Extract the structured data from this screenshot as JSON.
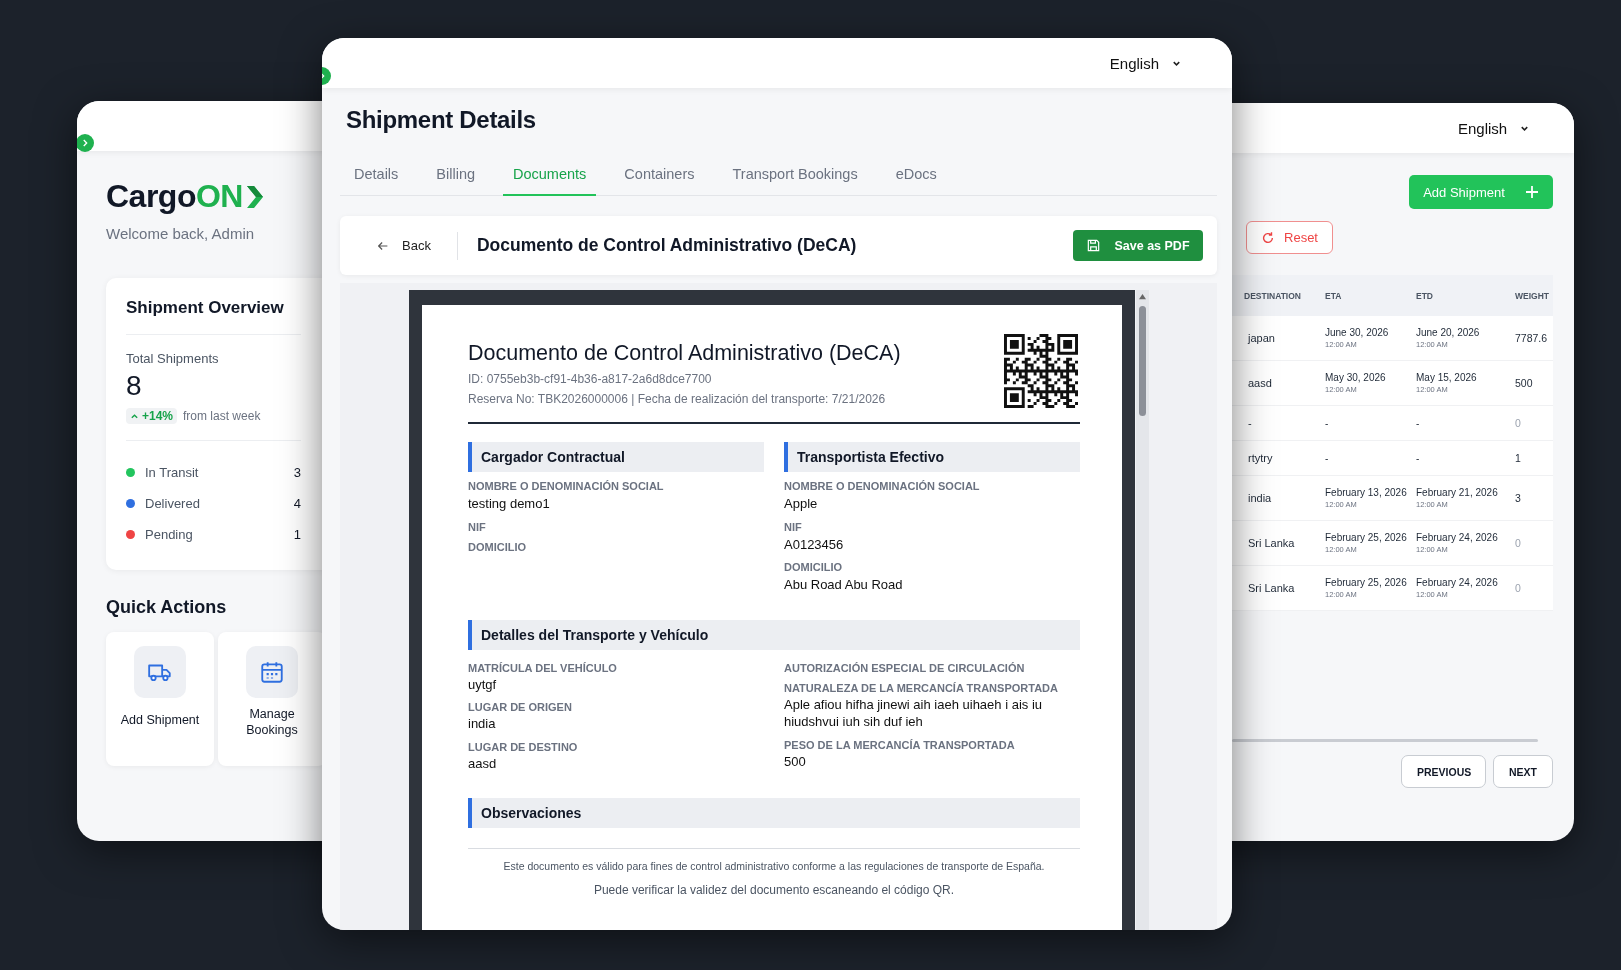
{
  "left_window": {
    "logo": {
      "text": "Cargo",
      "accent": "ON"
    },
    "welcome": "Welcome back, Admin",
    "overview": {
      "title": "Shipment Overview",
      "total_label": "Total Shipments",
      "total": "8",
      "change": "+14%",
      "change_note": "from last week",
      "statuses": [
        {
          "label": "In Transit",
          "count": "3",
          "color": "#22c55e"
        },
        {
          "label": "Delivered",
          "count": "4",
          "color": "#2f6fe0"
        },
        {
          "label": "Pending",
          "count": "1",
          "color": "#ef4444"
        }
      ]
    },
    "quick_actions": {
      "title": "Quick Actions",
      "items": [
        {
          "label": "Add Shipment",
          "kind": "truck"
        },
        {
          "label": "Manage Bookings",
          "kind": "calendar"
        }
      ]
    }
  },
  "center_window": {
    "language": "English",
    "title": "Shipment Details",
    "tabs": [
      {
        "label": "Details",
        "selected": false
      },
      {
        "label": "Billing",
        "selected": false
      },
      {
        "label": "Documents",
        "selected": true
      },
      {
        "label": "Containers",
        "selected": false
      },
      {
        "label": "Transport Bookings",
        "selected": false
      },
      {
        "label": "eDocs",
        "selected": false
      }
    ],
    "toolbar": {
      "back": "Back",
      "title": "Documento de Control Administrativo (DeCA)",
      "save": "Save as PDF"
    },
    "document": {
      "title": "Documento de Control Administrativo (DeCA)",
      "id_line": "ID: 0755eb3b-cf91-4b36-a817-2a6d8dce7700",
      "meta_line": "Reserva No: TBK2026000006 | Fecha de realización del transporte: 7/21/2026",
      "parties": [
        {
          "heading": "Cargador Contractual",
          "fields": [
            {
              "label": "NOMBRE O DENOMINACIÓN SOCIAL",
              "value": "testing demo1"
            },
            {
              "label": "NIF"
            },
            {
              "label": "DOMICILIO"
            }
          ]
        },
        {
          "heading": "Transportista Efectivo",
          "fields": [
            {
              "label": "NOMBRE O DENOMINACIÓN SOCIAL",
              "value": "Apple"
            },
            {
              "label": "NIF",
              "value": "A0123456"
            },
            {
              "label": "DOMICILIO",
              "value": "Abu Road Abu Road"
            }
          ]
        }
      ],
      "transport": {
        "heading": "Detalles del Transporte y Vehículo",
        "columns": [
          [
            {
              "label": "MATRÍCULA DEL VEHÍCULO",
              "value": "uytgf"
            },
            {
              "label": "LUGAR DE ORIGEN",
              "value": "india"
            },
            {
              "label": "LUGAR DE DESTINO",
              "value": "aasd"
            }
          ],
          [
            {
              "label": "AUTORIZACIÓN ESPECIAL DE CIRCULACIÓN"
            },
            {
              "label": "NATURALEZA DE LA MERCANCÍA TRANSPORTADA",
              "value": "Aple afiou hifha jinewi aih iaeh uihaeh i ais iu hiudshvui iuh sih duf ieh"
            },
            {
              "label": "PESO DE LA MERCANCÍA TRANSPORTADA",
              "value": "500"
            }
          ]
        ]
      },
      "observations": {
        "heading": "Observaciones"
      },
      "footer": [
        "Este documento es válido para fines de control administrativo conforme a las regulaciones de transporte de España.",
        "Puede verificar la validez del documento escaneando el código QR."
      ]
    }
  },
  "right_window": {
    "language": "English",
    "add_button": "Add Shipment",
    "reset_button": "Reset",
    "table": {
      "columns": [
        "DESTINATION",
        "ETA",
        "ETD",
        "WEIGHT"
      ],
      "rows": [
        {
          "destination": "japan",
          "eta": {
            "date": "June 30, 2026",
            "time": "12:00 AM"
          },
          "etd": {
            "date": "June 20, 2026",
            "time": "12:00 AM"
          },
          "weight": "7787.6",
          "weight_muted": false
        },
        {
          "destination": "aasd",
          "eta": {
            "date": "May 30, 2026",
            "time": "12:00 AM"
          },
          "etd": {
            "date": "May 15, 2026",
            "time": "12:00 AM"
          },
          "weight": "500",
          "weight_muted": false
        },
        {
          "destination": "-",
          "eta": {
            "date": "-"
          },
          "etd": {
            "date": "-"
          },
          "weight": "0",
          "weight_muted": true
        },
        {
          "destination": "rtytry",
          "eta": {
            "date": "-"
          },
          "etd": {
            "date": "-"
          },
          "weight": "1",
          "weight_muted": false
        },
        {
          "destination": "india",
          "eta": {
            "date": "February 13, 2026",
            "time": "12:00 AM"
          },
          "etd": {
            "date": "February 21, 2026",
            "time": "12:00 AM"
          },
          "weight": "3",
          "weight_muted": false
        },
        {
          "destination": "Sri Lanka",
          "eta": {
            "date": "February 25, 2026",
            "time": "12:00 AM"
          },
          "etd": {
            "date": "February 24, 2026",
            "time": "12:00 AM"
          },
          "weight": "0",
          "weight_muted": true
        },
        {
          "destination": "Sri Lanka",
          "eta": {
            "date": "February 25, 2026",
            "time": "12:00 AM"
          },
          "etd": {
            "date": "February 24, 2026",
            "time": "12:00 AM"
          },
          "weight": "0",
          "weight_muted": true
        }
      ]
    },
    "pagination": [
      "PREVIOUS",
      "NEXT"
    ]
  }
}
